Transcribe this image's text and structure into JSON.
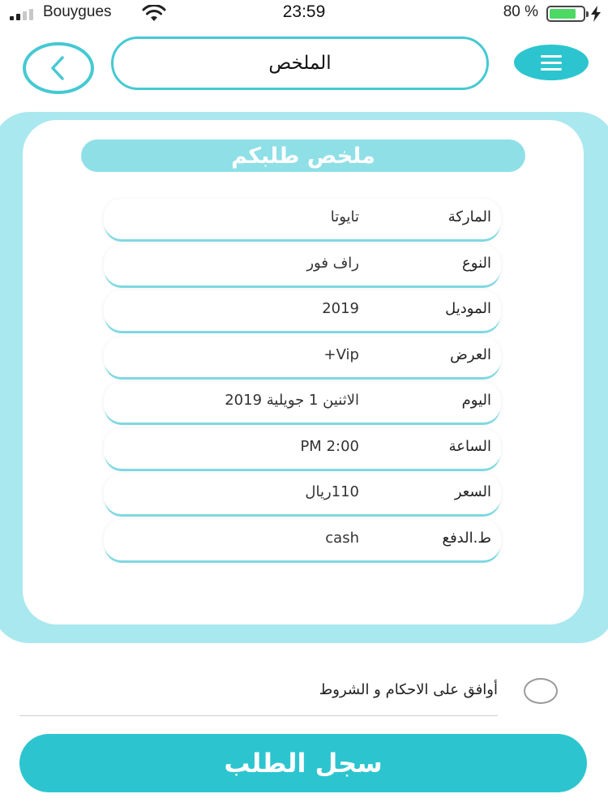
{
  "status_bar": {
    "carrier": "Bouygues",
    "time": "23:59",
    "battery_percent": "80 %",
    "battery_level": 0.8,
    "signal_bars": 2
  },
  "header": {
    "title": "الملخص",
    "back_icon": "chevron-left-icon",
    "menu_icon": "hamburger-menu-icon"
  },
  "summary": {
    "title": "ملخص طلبكم",
    "rows": [
      {
        "label": "الماركة",
        "value": "تايوتا"
      },
      {
        "label": "النوع",
        "value": "راف فور"
      },
      {
        "label": "الموديل",
        "value": "2019"
      },
      {
        "label": "العرض",
        "value": "Vip+"
      },
      {
        "label": "اليوم",
        "value": "الاثنين 1 جويلية 2019"
      },
      {
        "label": "الساعة",
        "value": "2:00 PM"
      },
      {
        "label": "السعر",
        "value": "110ريال"
      },
      {
        "label": "ط.الدفع",
        "value": "cash"
      }
    ]
  },
  "terms": {
    "label": "أوافق على الاحكام و الشروط",
    "checked": false
  },
  "submit": {
    "label": "سجل الطلب"
  },
  "colors": {
    "accent": "#2cc5cf",
    "accent_light": "#a9e8ee",
    "title_bar": "#8fdfe7",
    "battery_fill": "#4cd964"
  }
}
